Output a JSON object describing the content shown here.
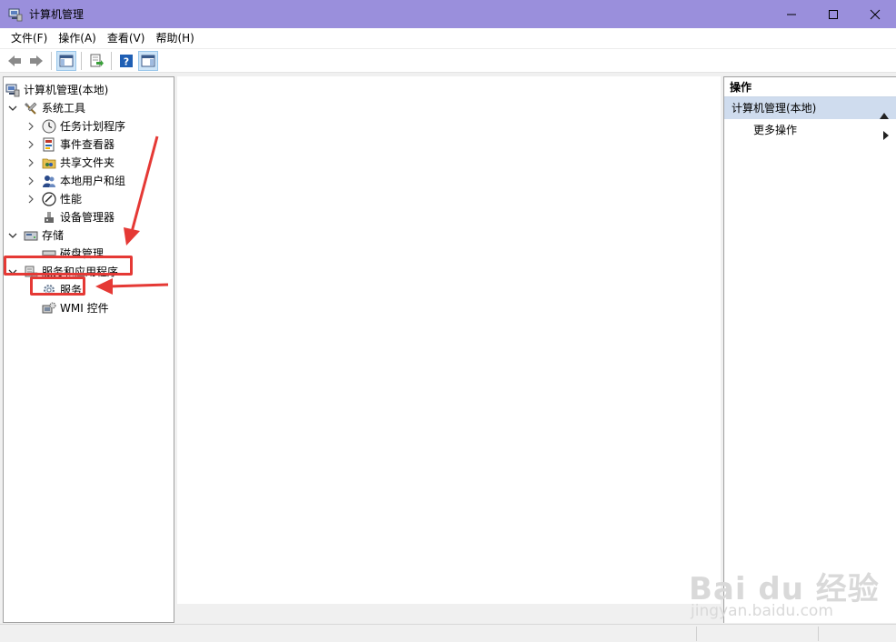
{
  "window": {
    "title": "计算机管理",
    "icon": "computer-management-icon"
  },
  "menu": [
    "文件(F)",
    "操作(A)",
    "查看(V)",
    "帮助(H)"
  ],
  "toolbar": [
    "back-arrow-icon",
    "forward-arrow-icon",
    "show-hide-console-tree-icon",
    "export-list-icon",
    "help-icon",
    "show-hide-action-pane-icon"
  ],
  "tree": {
    "root": "计算机管理(本地)",
    "system_tools": "系统工具",
    "task_scheduler": "任务计划程序",
    "event_viewer": "事件查看器",
    "shared_folders": "共享文件夹",
    "local_users": "本地用户和组",
    "performance": "性能",
    "device_manager": "设备管理器",
    "storage": "存储",
    "disk_management": "磁盘管理",
    "services_apps": "服务和应用程序",
    "services": "服务",
    "wmi": "WMI 控件"
  },
  "actions": {
    "header": "操作",
    "section": "计算机管理(本地)",
    "more": "更多操作"
  },
  "watermark": {
    "logo": "Bai du 经验",
    "url": "jingyan.baidu.com"
  },
  "colors": {
    "titlebar": "#9a8fdc",
    "annotation": "#e53935",
    "section_bg": "#cfdcee"
  }
}
